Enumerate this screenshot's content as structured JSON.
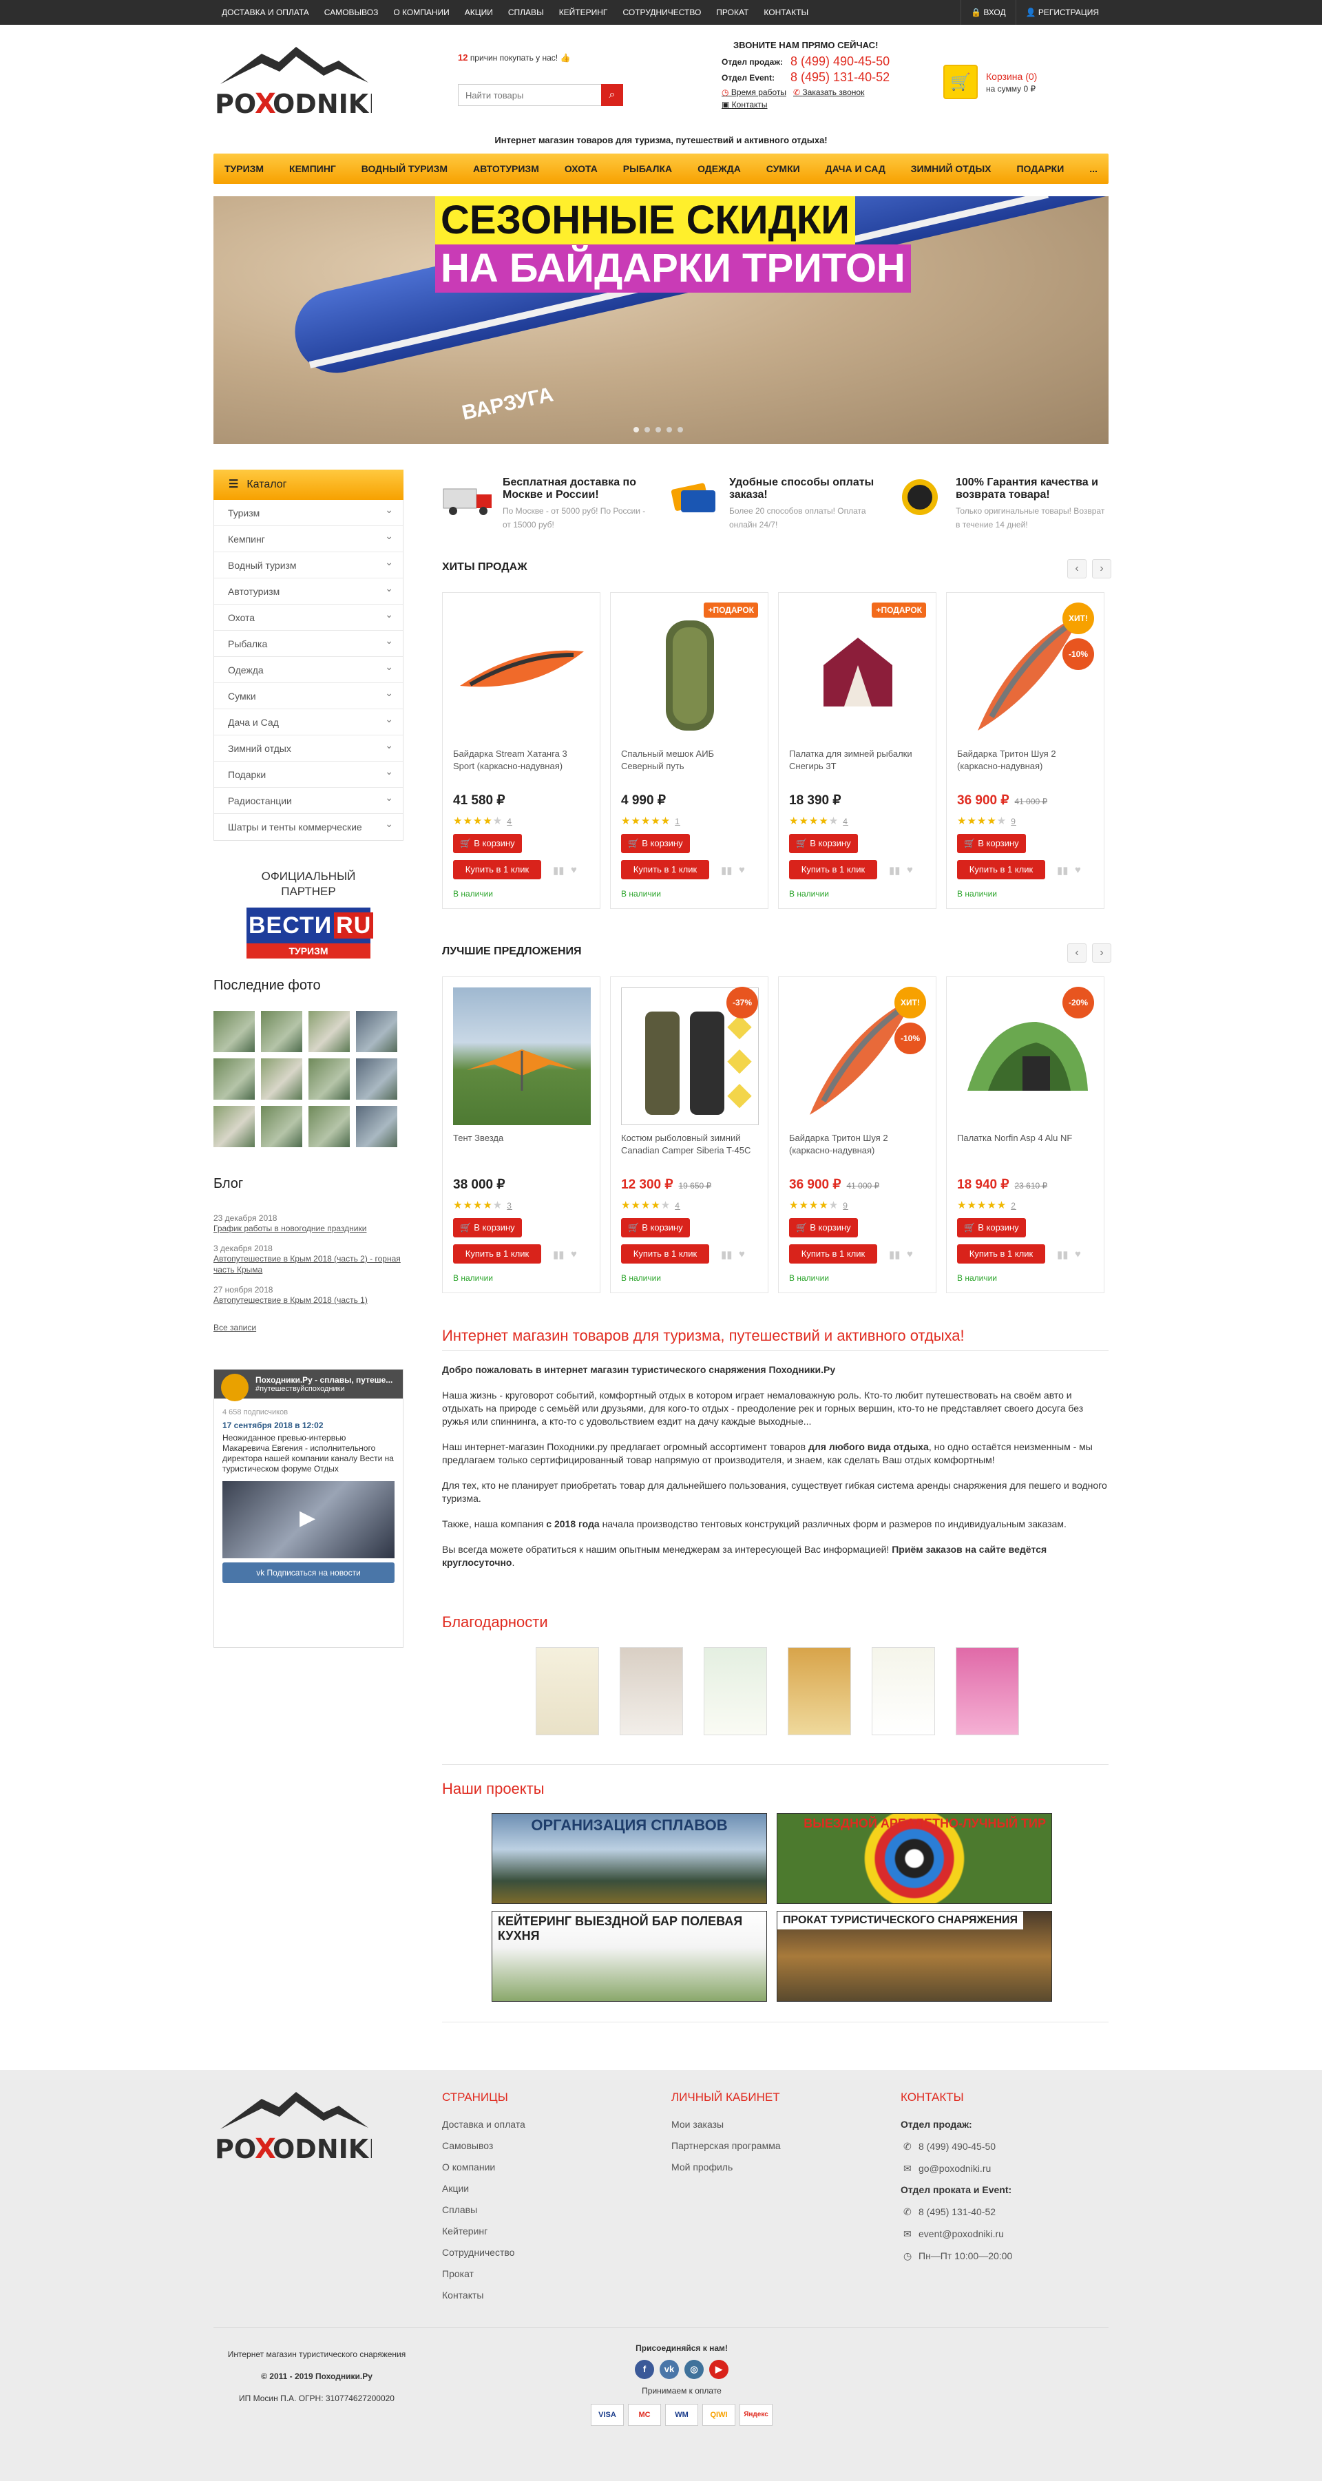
{
  "topbar": {
    "nav": [
      "Доставка и оплата",
      "Самовывоз",
      "О компании",
      "Акции",
      "Сплавы",
      "Кейтеринг",
      "Сотрудничество",
      "Прокат",
      "Контакты"
    ],
    "login": "ВХОД",
    "register": "РЕГИСТРАЦИЯ"
  },
  "header": {
    "logo_text": "POXODNIKI",
    "reasons_count": "12",
    "reasons_text": "причин покупать у нас!",
    "search_placeholder": "Найти товары",
    "call_title": "ЗВОНИТЕ НАМ ПРЯМО СЕЙЧАС!",
    "sales_label": "Отдел продаж:",
    "sales_phone": "8 (499) 490-45-50",
    "event_label": "Отдел Event:",
    "event_phone": "8 (495) 131-40-52",
    "work_time": "Время работы",
    "order_call": "Заказать звонок",
    "contacts": "Контакты",
    "cart_title": "Корзина (0)",
    "cart_sum": "на сумму 0 ₽",
    "tagline": "Интернет магазин товаров для туризма, путешествий и активного отдыха!"
  },
  "menu": [
    "Туризм",
    "Кемпинг",
    "Водный туризм",
    "Автотуризм",
    "Охота",
    "Рыбалка",
    "Одежда",
    "Сумки",
    "Дача и сад",
    "Зимний отдых",
    "Подарки",
    "..."
  ],
  "banner": {
    "line1": "СЕЗОННЫЕ СКИДКИ",
    "line2": "НА БАЙДАРКИ ТРИТОН",
    "boat_word": "ВАРЗУГА"
  },
  "catalog": {
    "title": "Каталог",
    "items": [
      "Туризм",
      "Кемпинг",
      "Водный туризм",
      "Автотуризм",
      "Охота",
      "Рыбалка",
      "Одежда",
      "Сумки",
      "Дача и Сад",
      "Зимний отдых",
      "Подарки",
      "Радиостанции",
      "Шатры и тенты коммерческие"
    ]
  },
  "partner": {
    "title": "ОФИЦИАЛЬНЫЙ ПАРТНЕР",
    "brand": "ВЕСТИ",
    "brand_ru": "RU",
    "brand_sub": "ТУРИЗМ"
  },
  "photos_title": "Последние фото",
  "blog": {
    "title": "Блог",
    "posts": [
      {
        "date": "23 декабря 2018",
        "title": "График работы в новогодние праздники"
      },
      {
        "date": "3 декабря 2018",
        "title": "Автопутешествие в Крым 2018 (часть 2) - горная часть Крыма"
      },
      {
        "date": "27 ноября 2018",
        "title": "Автопутешествие в Крым 2018 (часть 1)"
      }
    ],
    "all": "Все записи"
  },
  "vk": {
    "name": "Походники.Ру - сплавы, путеше...",
    "tag": "#путешествуйспоходники",
    "subs": "4 658 подписчиков",
    "date": "17 сентября 2018 в 12:02",
    "text": "Неожиданное превью-интервью Макаревича Евгения - исполнительного директора нашей компании каналу Вести на туристическом форуме Отдых",
    "button": "Подписаться на новости"
  },
  "features": [
    {
      "title": "Бесплатная доставка по Москве и России!",
      "sub": "По Москве - от 5000 руб! По России - от 15000 руб!"
    },
    {
      "title": "Удобные способы оплаты заказа!",
      "sub": "Более 20 способов оплаты! Оплата онлайн 24/7!"
    },
    {
      "title": "100% Гарантия качества и возврата товара!",
      "sub": "Только оригинальные товары! Возврат в течение 14 дней!"
    }
  ],
  "hits": {
    "title": "ХИТЫ ПРОДАЖ",
    "products": [
      {
        "name": "Байдарка Stream Хатанга 3 Sport (каркасно-надувная)",
        "price": "41 580 ₽",
        "old": "",
        "rating": "4",
        "reviews": "4",
        "badges": []
      },
      {
        "name": "Спальный мешок АИБ Северный путь",
        "price": "4 990 ₽",
        "old": "",
        "rating": "5",
        "reviews": "1",
        "badges": [
          "+ПОДАРОК"
        ]
      },
      {
        "name": "Палатка для зимней рыбалки Снегирь 3Т",
        "price": "18 390 ₽",
        "old": "",
        "rating": "4",
        "reviews": "4",
        "badges": [
          "+ПОДАРОК"
        ]
      },
      {
        "name": "Байдарка Тритон Шуя 2 (каркасно-надувная)",
        "price": "36 900 ₽",
        "old": "41 000 ₽",
        "rating": "4",
        "reviews": "9",
        "badges": [
          "ХИТ!",
          "-10%"
        ]
      }
    ]
  },
  "best": {
    "title": "ЛУЧШИЕ ПРЕДЛОЖЕНИЯ",
    "products": [
      {
        "name": "Тент Звезда",
        "price": "38 000 ₽",
        "old": "",
        "rating": "4",
        "reviews": "3",
        "badges": []
      },
      {
        "name": "Костюм рыболовный зимний Canadian Camper Siberia T-45C",
        "price": "12 300 ₽",
        "old": "19 650 ₽",
        "rating": "4",
        "reviews": "4",
        "badges": [
          "-37%"
        ]
      },
      {
        "name": "Байдарка Тритон Шуя 2 (каркасно-надувная)",
        "price": "36 900 ₽",
        "old": "41 000 ₽",
        "rating": "4",
        "reviews": "9",
        "badges": [
          "ХИТ!",
          "-10%"
        ]
      },
      {
        "name": "Палатка Norfin Asp 4 Alu NF",
        "price": "18 940 ₽",
        "old": "23 610 ₽",
        "rating": "5",
        "reviews": "2",
        "badges": [
          "-20%"
        ]
      }
    ]
  },
  "product_ui": {
    "cart_btn": "В корзину",
    "buy_btn": "Купить в 1 клик",
    "stock": "В наличии"
  },
  "welcome": {
    "title": "Интернет магазин товаров для туризма, путешествий и активного отдыха!",
    "bold": "Добро пожаловать в интернет магазин туристического снаряжения Походники.Ру",
    "p1": "Наша жизнь - круговорот событий, комфортный отдых в котором играет немаловажную роль. Кто-то любит путешествовать на своём авто и отдыхать на природе с семьёй или друзьями, для кого-то отдых - преодоление рек и горных вершин, кто-то не представляет своего досуга без ружья или спиннинга, а кто-то с удовольствием ездит на дачу каждые выходные...",
    "p2a": "Наш интернет-магазин Походники.ру предлагает огромный ассортимент товаров ",
    "p2b": "для любого вида отдыха",
    "p2c": ", но одно остаётся неизменным - мы предлагаем только сертифицированный товар напрямую от производителя, и знаем, как сделать Ваш отдых комфортным!",
    "p3": "Для тех, кто не планирует приобретать товар для дальнейшего пользования, существует гибкая система аренды снаряжения для пешего и водного туризма.",
    "p4a": "Также, наша компания ",
    "p4b": "с 2018 года",
    "p4c": " начала производство тентовых конструкций различных форм и размеров по индивидуальным заказам.",
    "p5a": "Вы всегда можете обратиться к нашим опытным менеджерам за интересующей Вас информацией! ",
    "p5b": "Приём заказов на сайте ведётся круглосуточно",
    "p5c": "."
  },
  "thanks_title": "Благодарности",
  "projects": {
    "title": "Наши проекты",
    "items": [
      "ОРГАНИЗАЦИЯ СПЛАВОВ",
      "ВЫЕЗДНОЙ АРБАЛЕТНО-ЛУЧНЫЙ ТИР",
      "КЕЙТЕРИНГ ВЫЕЗДНОЙ БАР ПОЛЕВАЯ КУХНЯ",
      "ПРОКАТ ТУРИСТИЧЕСКОГО СНАРЯЖЕНИЯ"
    ]
  },
  "footer": {
    "pages_title": "СТРАНИЦЫ",
    "pages": [
      "Доставка и оплата",
      "Самовывоз",
      "О компании",
      "Акции",
      "Сплавы",
      "Кейтеринг",
      "Сотрудничество",
      "Прокат",
      "Контакты"
    ],
    "cabinet_title": "ЛИЧНЫЙ КАБИНЕТ",
    "cabinet": [
      "Мои заказы",
      "Партнерская программа",
      "Мой профиль"
    ],
    "contacts_title": "КОНТАКТЫ",
    "sales_label": "Отдел продаж:",
    "sales_phone": "8 (499) 490-45-50",
    "sales_mail": "go@poxodniki.ru",
    "event_label": "Отдел проката и Event:",
    "event_phone": "8 (495) 131-40-52",
    "event_mail": "event@poxodniki.ru",
    "hours": "Пн—Пт 10:00—20:00",
    "bottom_1": "Интернет магазин туристического снаряжения",
    "bottom_2": "© 2011 - 2019 Походники.Ру",
    "bottom_3": "ИП Мосин П.А. ОГРН: 310774627200020",
    "join": "Присоединяйся к нам!",
    "accept": "Принимаем к оплате",
    "pays": [
      "VISA",
      "MC",
      "WM",
      "QIWI",
      "Яндекс"
    ]
  }
}
